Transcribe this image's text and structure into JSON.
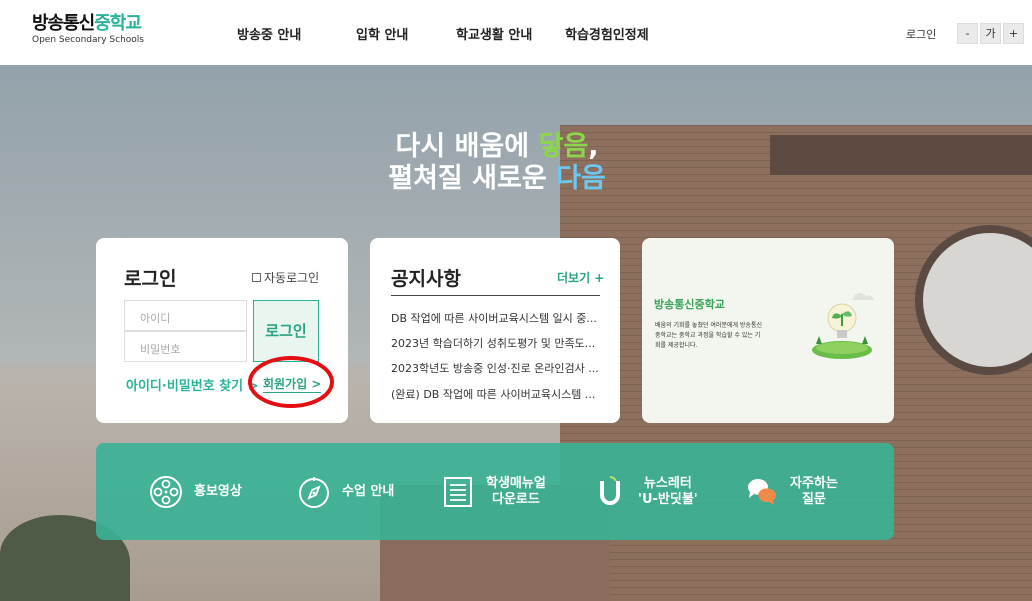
{
  "header": {
    "logo_main_a": "방송통신",
    "logo_main_b": "중학교",
    "logo_sub": "Open Secondary Schools",
    "nav": [
      "방송중 안내",
      "입학 안내",
      "학교생활 안내",
      "학습경험인정제"
    ],
    "login": "로그인",
    "font_minus": "-",
    "font_label": "가",
    "font_plus": "+"
  },
  "hero": {
    "line1_a": "다시 배움에 ",
    "line1_b": "닿음",
    "line1_c": ",",
    "line2_a": "펼쳐질 새로운 ",
    "line2_b": "다음"
  },
  "login_box": {
    "title": "로그인",
    "auto_login": "자동로그인",
    "id_placeholder": "아이디",
    "pw_placeholder": "비밀번호",
    "submit": "로그인",
    "find": "아이디·비밀번호 찾기 >",
    "join": "회원가입 >"
  },
  "notice": {
    "title": "공지사항",
    "more": "더보기 +",
    "items": [
      "DB 작업에 따른 사이버교육시스템 일시 중...",
      "2023년 학습더하기 성취도평가 및 만족도...",
      "2023학년도 방송중 인성·진로 온라인검사 ...",
      "(완료) DB 작업에 따른 사이버교육시스템 ..."
    ]
  },
  "promo": {
    "title": "방송통신중학교",
    "desc": "배움의 기회를 놓쳤던 여러분에게 방송통신중학교는 중학교 과정을 학습할 수 있는 기회를 제공합니다."
  },
  "quick_menu": [
    {
      "label": "홍보영상",
      "icon": "film-reel-icon"
    },
    {
      "label": "수업 안내",
      "icon": "compass-icon"
    },
    {
      "label": "학생매뉴얼\n다운로드",
      "icon": "manual-icon"
    },
    {
      "label": "뉴스레터\n'U-반딧불'",
      "icon": "magnet-u-icon"
    },
    {
      "label": "자주하는\n질문",
      "icon": "chat-bubbles-icon"
    }
  ],
  "colors": {
    "accent": "#2bb39a",
    "hero_green": "#8cd64c",
    "hero_blue": "#6cc8f0",
    "highlight_ring": "#e40f12"
  }
}
